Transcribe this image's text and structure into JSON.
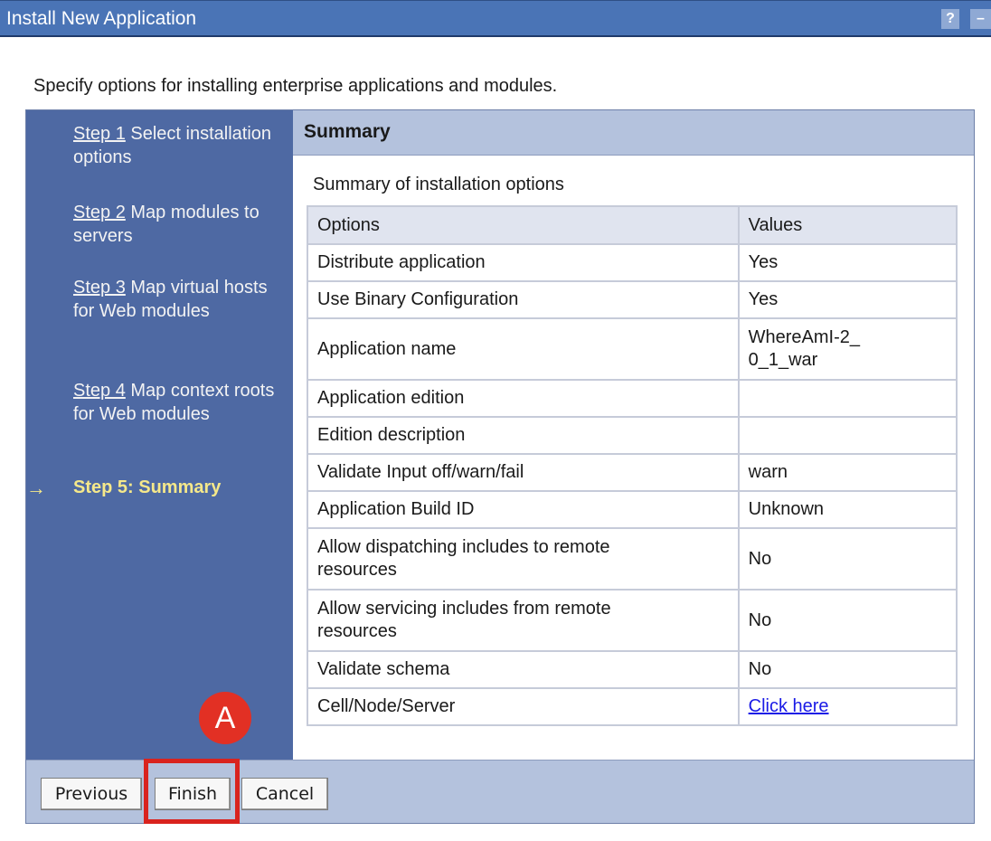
{
  "window": {
    "title": "Install New Application",
    "help_label": "?",
    "minimize_label": "–"
  },
  "intro_text": "Specify options for installing enterprise applications and modules.",
  "sidebar": {
    "steps": [
      {
        "link": "Step 1",
        "text": "Select installation options"
      },
      {
        "link": "Step 2",
        "text": "Map modules to servers"
      },
      {
        "link": "Step 3",
        "text": "Map virtual hosts for Web modules"
      },
      {
        "link": "Step 4",
        "text": "Map context roots for Web modules"
      }
    ],
    "current_arrow": "→",
    "current_step": "Step 5: Summary"
  },
  "panel": {
    "header": "Summary",
    "caption": "Summary of installation options",
    "columns": [
      "Options",
      "Values"
    ],
    "rows": [
      {
        "option": "Distribute application",
        "value": "Yes"
      },
      {
        "option": "Use Binary Configuration",
        "value": "Yes"
      },
      {
        "option": "Application name",
        "value": "WhereAmI-2_0_1_war"
      },
      {
        "option": "Application edition",
        "value": ""
      },
      {
        "option": "Edition description",
        "value": ""
      },
      {
        "option": "Validate Input off/warn/fail",
        "value": "warn"
      },
      {
        "option": "Application Build ID",
        "value": "Unknown"
      },
      {
        "option": "Allow dispatching includes to remote resources",
        "value": "No"
      },
      {
        "option": "Allow servicing includes from remote resources",
        "value": "No"
      },
      {
        "option": "Validate schema",
        "value": "No"
      },
      {
        "option": "Cell/Node/Server",
        "value": "Click here"
      }
    ]
  },
  "buttons": {
    "previous": "Previous",
    "finish": "Finish",
    "cancel": "Cancel"
  },
  "annotation": {
    "marker_label": "A",
    "marker_color": "#e23024"
  }
}
